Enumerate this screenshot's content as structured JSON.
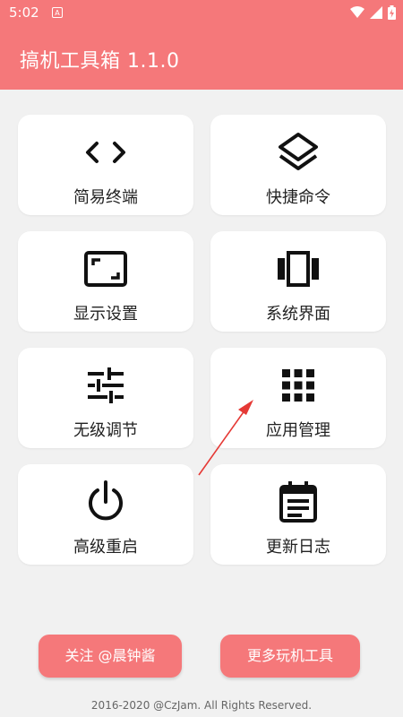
{
  "status": {
    "time": "5:02",
    "notif": "A"
  },
  "app": {
    "title": "搞机工具箱 1.1.0"
  },
  "tools": [
    {
      "label": "简易终端",
      "icon": "code-icon"
    },
    {
      "label": "快捷命令",
      "icon": "layers-icon"
    },
    {
      "label": "显示设置",
      "icon": "aspect-ratio-icon"
    },
    {
      "label": "系统界面",
      "icon": "view-carousel-icon"
    },
    {
      "label": "无级调节",
      "icon": "tune-icon"
    },
    {
      "label": "应用管理",
      "icon": "apps-grid-icon"
    },
    {
      "label": "高级重启",
      "icon": "power-icon"
    },
    {
      "label": "更新日志",
      "icon": "event-note-icon"
    }
  ],
  "buttons": {
    "follow": "关注 @晨钟酱",
    "more_tools": "更多玩机工具"
  },
  "footer": "2016-2020 @CzJam. All Rights Reserved.",
  "colors": {
    "accent": "#f5787a",
    "background": "#f1f1f1",
    "annotation_arrow": "#e53935"
  }
}
